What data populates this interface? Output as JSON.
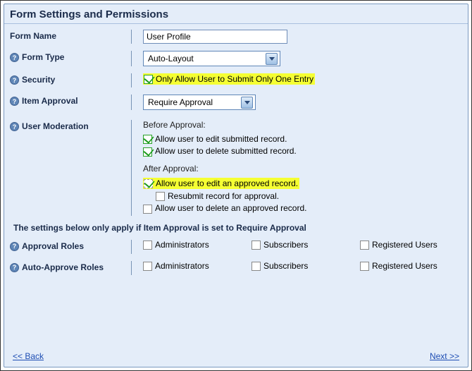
{
  "header": "Form Settings and Permissions",
  "formName": {
    "label": "Form Name",
    "value": "User Profile"
  },
  "formType": {
    "label": "Form Type",
    "value": "Auto-Layout"
  },
  "security": {
    "label": "Security",
    "checkboxLabel": "Only Allow User to Submit Only One Entry"
  },
  "itemApproval": {
    "label": "Item Approval",
    "value": "Require Approval"
  },
  "userModeration": {
    "label": "User Moderation",
    "beforeHeader": "Before Approval:",
    "beforeEdit": "Allow user to edit submitted record.",
    "beforeDelete": "Allow user to delete submitted record.",
    "afterHeader": "After Approval:",
    "afterEdit": "Allow user to edit an approved record.",
    "afterResubmit": "Resubmit record for approval.",
    "afterDelete": "Allow user to delete an approved record."
  },
  "note": "The settings below only apply if Item Approval is set to Require Approval",
  "approvalRoles": {
    "label": "Approval Roles",
    "admin": "Administrators",
    "subs": "Subscribers",
    "reg": "Registered Users"
  },
  "autoApproveRoles": {
    "label": "Auto-Approve Roles",
    "admin": "Administrators",
    "subs": "Subscribers",
    "reg": "Registered Users"
  },
  "nav": {
    "back": "<< Back",
    "next": "Next >>"
  }
}
